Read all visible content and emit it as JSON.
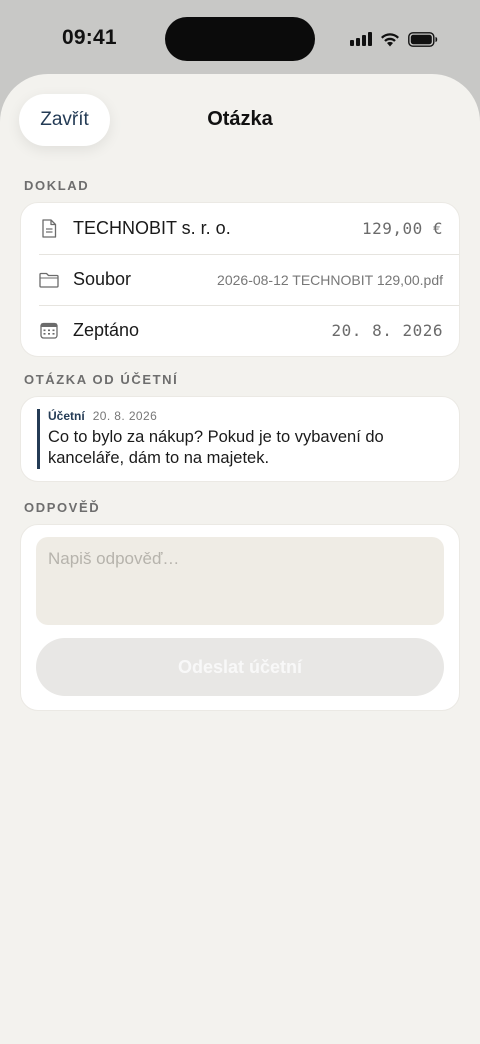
{
  "status_bar": {
    "time": "09:41"
  },
  "header": {
    "close_label": "Zavřít",
    "title": "Otázka"
  },
  "doklad": {
    "section_label": "DOKLAD",
    "rows": [
      {
        "icon": "document-icon",
        "label": "TECHNOBIT s. r. o.",
        "value": "129,00 €"
      },
      {
        "icon": "folder-icon",
        "label": "Soubor",
        "value": "2026-08-12 TECHNOBIT 129,00.pdf"
      },
      {
        "icon": "calendar-icon",
        "label": "Zeptáno",
        "value": "20. 8. 2026"
      }
    ]
  },
  "question": {
    "section_label": "OTÁZKA OD ÚČETNÍ",
    "author": "Účetní",
    "date": "20. 8. 2026",
    "text": "Co to bylo za nákup? Pokud je to vybavení do kanceláře, dám to na majetek."
  },
  "answer": {
    "section_label": "ODPOVĚĎ",
    "input_value": "",
    "placeholder": "Napiš odpověď…",
    "send_label": "Odeslat účetní",
    "send_enabled": false
  },
  "colors": {
    "accent": "#243b55",
    "sheet_background": "#f3f2ee",
    "card_background": "#ffffff",
    "input_background": "#efece5",
    "disabled_button": "#e8e7e5"
  }
}
